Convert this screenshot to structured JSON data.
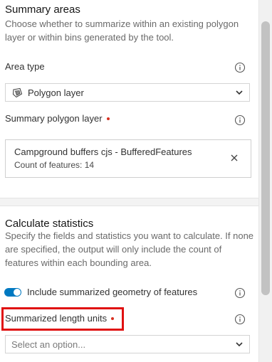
{
  "summary_areas": {
    "title": "Summary areas",
    "description": "Choose whether to summarize within an existing polygon layer or within bins generated by the tool."
  },
  "area_type": {
    "label": "Area type",
    "selected": "Polygon layer",
    "selected_icon": "polygon-layer-icon"
  },
  "summary_polygon_layer": {
    "label": "Summary polygon layer",
    "layer_name": "Campground buffers cjs - BufferedFeatures",
    "feature_count": "Count of features: 14"
  },
  "calculate_statistics": {
    "title": "Calculate statistics",
    "description": "Specify the fields and statistics you want to calculate. If none are specified, the output will only include the count of features within each bounding area."
  },
  "include_geometry": {
    "label": "Include summarized geometry of features",
    "enabled": true
  },
  "length_units": {
    "label": "Summarized length units",
    "placeholder": "Select an option..."
  },
  "colors": {
    "accent": "#0079c1",
    "required": "#d83020",
    "highlight": "#e01010"
  }
}
